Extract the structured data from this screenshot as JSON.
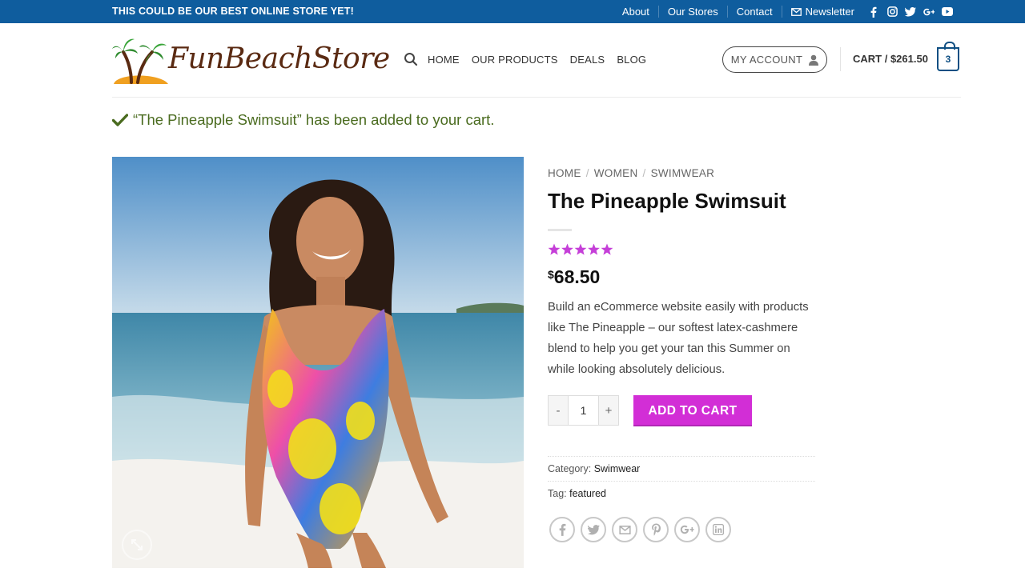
{
  "topbar": {
    "promo": "THIS COULD BE OUR BEST ONLINE STORE YET!",
    "links": [
      "About",
      "Our Stores",
      "Contact",
      "Newsletter"
    ],
    "social_icons": [
      "facebook-icon",
      "instagram-icon",
      "twitter-icon",
      "google-plus-icon",
      "youtube-icon"
    ],
    "bg_color": "#0f5d9e"
  },
  "header": {
    "logo_text": "FunBeachStore",
    "nav": [
      "HOME",
      "OUR PRODUCTS",
      "DEALS",
      "BLOG"
    ],
    "account_label": "MY ACCOUNT",
    "cart_label": "CART / ",
    "cart_amount": "$261.50",
    "cart_count": "3"
  },
  "notice": {
    "text": "“The Pineapple Swimsuit” has been added to your cart."
  },
  "product": {
    "breadcrumbs": [
      "HOME",
      "WOMEN",
      "SWIMWEAR"
    ],
    "title": "The Pineapple Swimsuit",
    "rating": 5,
    "price_currency": "$",
    "price_value": "68.50",
    "description": "Build an eCommerce website easily with products like The Pineapple – our softest latex-cashmere blend to help you get your tan this Summer on while looking absolutely delicious.",
    "quantity": "1",
    "qty_minus": "-",
    "qty_plus": "+",
    "add_to_cart": "ADD TO CART",
    "category_label": "Category:",
    "category_value": "Swimwear",
    "tag_label": "Tag:",
    "tag_value": "featured",
    "share_icons": [
      "facebook-icon",
      "twitter-icon",
      "email-icon",
      "pinterest-icon",
      "google-plus-icon",
      "linkedin-icon"
    ],
    "accent_color": "#d22ed6"
  }
}
